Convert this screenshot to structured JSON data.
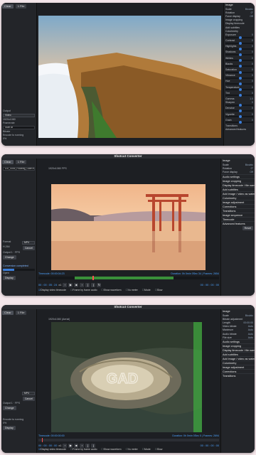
{
  "app": {
    "title": "Shotcut Converter"
  },
  "colors": {
    "accent": "#3b7dd8",
    "timecode": "#4da3ff",
    "playhead": "#ff5050",
    "background": "#f4e6ea"
  },
  "s1": {
    "left": {
      "tabs": [
        "Clear",
        "1 File"
      ],
      "rows": [
        "Output",
        "Video",
        "1920x1080",
        "Framerate",
        "Start at",
        "Bitrate",
        "Auto"
      ],
      "queue_label": "Encode to running",
      "queue_value": "0%"
    },
    "right": {
      "title": "Image",
      "rows": [
        {
          "l": "Scale",
          "v": "Bicubic"
        },
        {
          "l": "Rotation",
          "v": "0°"
        },
        {
          "l": "Force display",
          "v": "Off"
        },
        {
          "l": "Image cropping",
          "v": ""
        },
        {
          "l": "Display timecode",
          "v": ""
        },
        {
          "l": "Add subtitles",
          "v": ""
        },
        {
          "l": "Colorimetry",
          "v": ""
        },
        {
          "l": "Exposure",
          "v": "0"
        },
        {
          "l": "Contrast",
          "v": "0"
        },
        {
          "l": "Highlights",
          "v": "0"
        },
        {
          "l": "Shadows",
          "v": "0"
        },
        {
          "l": "Whites",
          "v": "0"
        },
        {
          "l": "Blacks",
          "v": "0"
        },
        {
          "l": "Saturation",
          "v": "0"
        },
        {
          "l": "Vibrance",
          "v": "0"
        },
        {
          "l": "Hue",
          "v": "0"
        },
        {
          "l": "Temperature",
          "v": "0"
        },
        {
          "l": "Tint",
          "v": "0"
        },
        {
          "l": "Gamma",
          "v": "1.0"
        },
        {
          "l": "Sharpen",
          "v": "0"
        },
        {
          "l": "Denoise",
          "v": "0"
        },
        {
          "l": "Vignette",
          "v": "0"
        },
        {
          "l": "Grain",
          "v": "0"
        },
        {
          "l": "Transitions",
          "v": ""
        },
        {
          "l": "Advanced features",
          "v": ""
        }
      ]
    }
  },
  "s2": {
    "title": "Shotcut Converter",
    "left": {
      "tabs": [
        "Clear",
        "1 File"
      ],
      "file": "DJI_0045_Floating_Gate.mp4",
      "format_label": "Format",
      "format_value": "MP4",
      "codec_label": "H.264",
      "cancel": "Cancel",
      "output_label": "Output 1 · FPS",
      "change": "Change",
      "status_title": "Conversion completed",
      "status_sub": "Open",
      "display": "Display"
    },
    "viewer_label": "1920x1080 FPS",
    "timecode_left": "Timecode: 00:00:04:23",
    "duration_right": "Duration: 0h 0min 0Sec 34 | Frames: 2654",
    "transport": {
      "time_start": "00 : 00 : 05 : 24",
      "speed": "x1",
      "time_end": "00 : 00 : 00 : 00",
      "mode_label": "Mode",
      "mode_value": "Slow"
    },
    "checks": [
      "Display video timecode",
      "Frame by frame audio",
      "Show waveform",
      "Vu meter"
    ],
    "right": {
      "title": "Image",
      "rows": [
        {
          "l": "Scale",
          "v": "Bicubic"
        },
        {
          "l": "Rotation",
          "v": "0°"
        },
        {
          "l": "Force display",
          "v": "Off"
        }
      ],
      "sections": [
        "Audio settings",
        "Image cropping",
        "Display timecode / file name",
        "Add subtitles",
        "Add image / video as watermark",
        "Colorimetry",
        "Image adjustment",
        "Corrections",
        "Transitions",
        "Image sequence",
        "Timecode",
        "Advanced features"
      ],
      "reset": "Reset"
    },
    "progress_pct": 35
  },
  "s3": {
    "title": "Shotcut Converter",
    "left": {
      "tabs": [
        "Clear",
        "1 File"
      ],
      "format_value": "MP4",
      "cancel": "Cancel",
      "output_label": "Output 1 · FPS",
      "change": "Change",
      "queue_label": "Encode to running",
      "queue_value": "0%",
      "display": "Display"
    },
    "viewer_label": "1920x1080 (Aerial)",
    "watermark": "GAD",
    "timecode_left": "Timecode: 00:00:00:00",
    "duration_right": "Duration: 0h 0min 0Sec 0 | Frames: 2694",
    "transport": {
      "time_start": "00 : 00 : 00 : 00",
      "speed": "x1",
      "time_end": "00 : 00 : 00 : 00",
      "mode_label": "Mode",
      "mode_value": "Slow"
    },
    "checks": [
      "Display video timecode",
      "Frame by frame audio",
      "Show waveform",
      "Vu meter"
    ],
    "right": {
      "title": "Image",
      "rows": [
        {
          "l": "Scale",
          "v": "Bicubic"
        },
        {
          "l": "Bitrate adjustment",
          "v": ""
        },
        {
          "l": "Length",
          "v": "00:00:00"
        },
        {
          "l": "Video bitrate",
          "v": "Auto"
        },
        {
          "l": "Maximum",
          "v": "Auto"
        },
        {
          "l": "Audio bitrate",
          "v": "Auto"
        },
        {
          "l": "File size",
          "v": "Auto"
        }
      ],
      "sections": [
        "Audio settings",
        "Image cropping",
        "Display timecode / file name",
        "Add subtitles",
        "Add image / video as watermark",
        "Colorimetry",
        "Image adjustment",
        "Corrections",
        "Transitions"
      ]
    }
  }
}
